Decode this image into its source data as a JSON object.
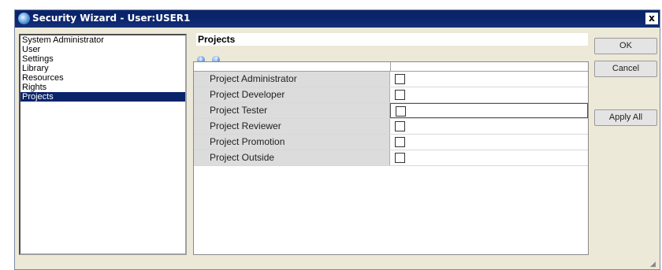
{
  "window": {
    "title": "Security Wizard - User:USER1",
    "close_glyph": "x"
  },
  "nav": {
    "items": [
      {
        "label": "System Administrator",
        "selected": false
      },
      {
        "label": "User",
        "selected": false
      },
      {
        "label": "Settings",
        "selected": false
      },
      {
        "label": "Library",
        "selected": false
      },
      {
        "label": "Resources",
        "selected": false
      },
      {
        "label": "Rights",
        "selected": false
      },
      {
        "label": "Projects",
        "selected": true
      }
    ]
  },
  "main": {
    "section_title": "Projects",
    "toolbar_icons": [
      "info-icon",
      "help-icon"
    ],
    "rows": [
      {
        "label": "Project Administrator",
        "checked": false
      },
      {
        "label": "Project Developer",
        "checked": false
      },
      {
        "label": "Project Tester",
        "checked": false,
        "focused": true
      },
      {
        "label": "Project Reviewer",
        "checked": false
      },
      {
        "label": "Project Promotion",
        "checked": false
      },
      {
        "label": "Project Outside",
        "checked": false
      }
    ]
  },
  "buttons": {
    "ok": "OK",
    "cancel": "Cancel",
    "apply_all": "Apply All"
  },
  "colors": {
    "titlebar": "#0a246a",
    "selection": "#0a246a",
    "dialog_bg": "#ece9d8"
  }
}
